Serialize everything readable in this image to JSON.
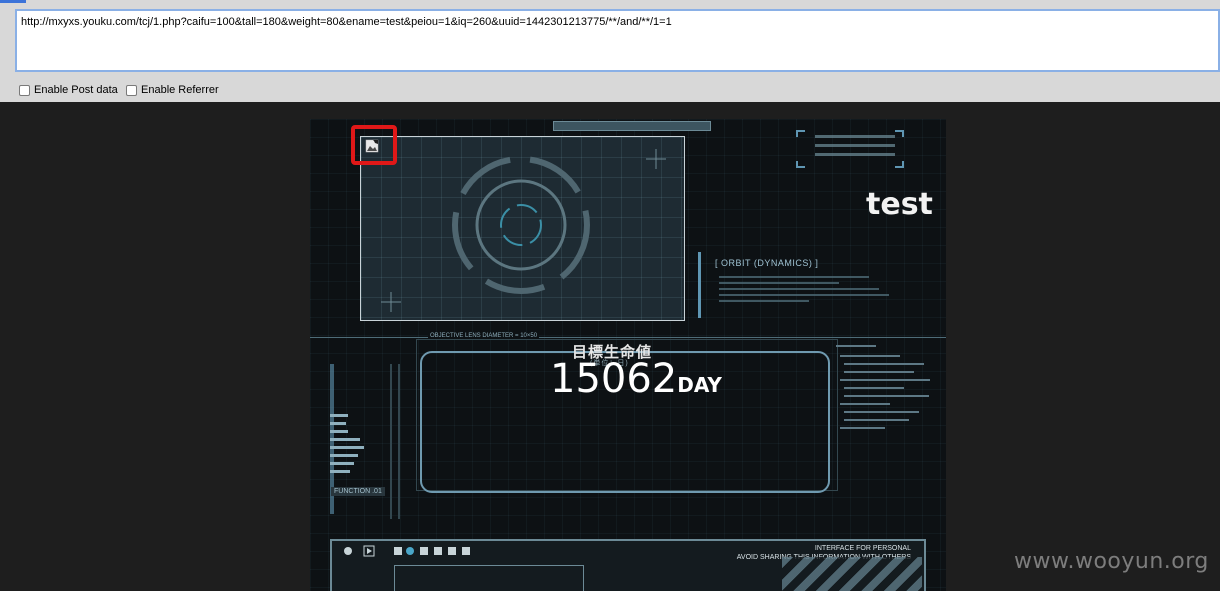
{
  "browser": {
    "url": "http://mxyxs.youku.com/tcj/1.php?caifu=100&tall=180&weight=80&ename=test&peiou=1&iq=260&uuid=1442301213775/**/and/**/1=1",
    "options": [
      {
        "label": "Enable Post data",
        "checked": false
      },
      {
        "label": "Enable Referrer",
        "checked": false
      }
    ]
  },
  "poster": {
    "name": "test",
    "orbit_title": "[ ORBIT (DYNAMICS) ]",
    "lens_label": "OBJECTIVE LENS DIAMETER = 10×50",
    "life_title": "目標生命値",
    "life_sub": "(単位：日)",
    "life_value": "15062",
    "life_unit": "DAY",
    "function_label": "FUNCTION .01",
    "interface_lines": [
      "INTERFACE FOR PERSONAL",
      "AVOID SHARING THIS INFORMATION WITH OTHERS"
    ],
    "broken_image_icon": "broken-image-icon",
    "highlight_color": "#e01818"
  },
  "watermark": "www.wooyun.org"
}
